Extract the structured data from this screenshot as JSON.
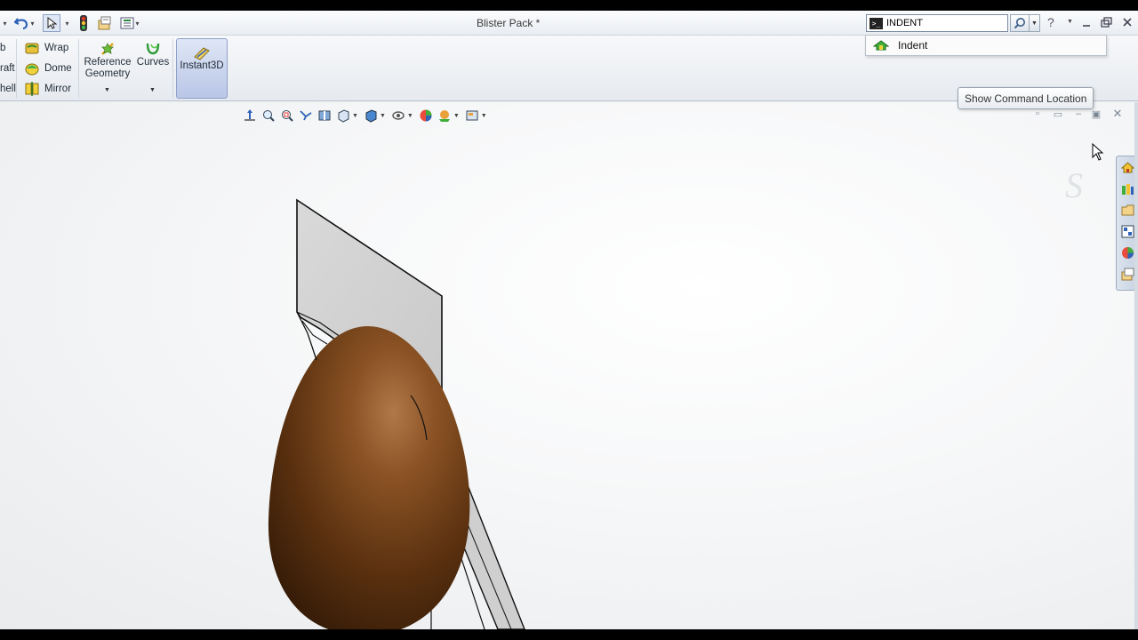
{
  "window": {
    "title": "Blister Pack *"
  },
  "search": {
    "value": "INDENT",
    "result_label": "Indent",
    "tooltip": "Show Command Location"
  },
  "ribbon": {
    "partial_left": [
      "b",
      "raft",
      "hell"
    ],
    "small_buttons": [
      "Wrap",
      "Dome",
      "Mirror"
    ],
    "reference_geometry": [
      "Reference",
      "Geometry"
    ],
    "curves": "Curves",
    "instant3d": "Instant3D"
  },
  "icons": {
    "quick_access": [
      "undo-icon",
      "select-icon",
      "rebuild-traffic-light-icon",
      "file-properties-icon",
      "options-icon"
    ],
    "view_toolbar": [
      "normal-to-icon",
      "zoom-to-fit-icon",
      "zoom-to-area-icon",
      "previous-view-icon",
      "section-view-icon",
      "view-orientation-icon",
      "display-style-icon",
      "hide-show-items-icon",
      "edit-appearance-icon",
      "apply-scene-icon",
      "view-settings-icon"
    ],
    "task_pane": [
      "solidworks-resources-icon",
      "design-library-icon",
      "file-explorer-icon",
      "view-palette-icon",
      "appearances-icon",
      "custom-properties-icon"
    ]
  },
  "colors": {
    "egg_brown": "#6b3a14",
    "instant3d_active": "#c4cfea",
    "viewport_bg": "#f3f4f5"
  }
}
